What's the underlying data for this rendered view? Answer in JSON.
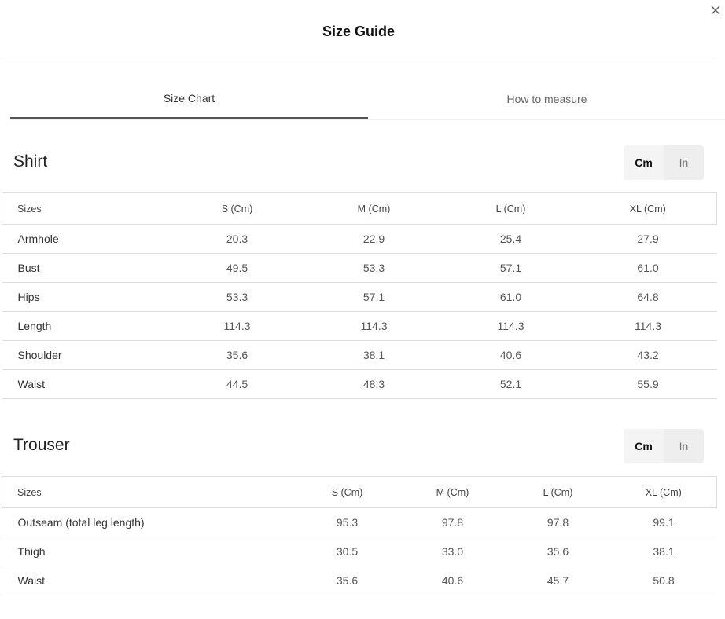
{
  "modal": {
    "title": "Size Guide",
    "close_icon": "close-icon"
  },
  "tabs": [
    {
      "label": "Size Chart",
      "active": true
    },
    {
      "label": "How to measure",
      "active": false
    }
  ],
  "shirt": {
    "title": "Shirt",
    "units": {
      "cm": "Cm",
      "in": "In",
      "selected": "Cm"
    },
    "columns": [
      "Sizes",
      "S (Cm)",
      "M (Cm)",
      "L (Cm)",
      "XL (Cm)"
    ],
    "rows": [
      [
        "Armhole",
        "20.3",
        "22.9",
        "25.4",
        "27.9"
      ],
      [
        "Bust",
        "49.5",
        "53.3",
        "57.1",
        "61.0"
      ],
      [
        "Hips",
        "53.3",
        "57.1",
        "61.0",
        "64.8"
      ],
      [
        "Length",
        "114.3",
        "114.3",
        "114.3",
        "114.3"
      ],
      [
        "Shoulder",
        "35.6",
        "38.1",
        "40.6",
        "43.2"
      ],
      [
        "Waist",
        "44.5",
        "48.3",
        "52.1",
        "55.9"
      ]
    ]
  },
  "trouser": {
    "title": "Trouser",
    "units": {
      "cm": "Cm",
      "in": "In",
      "selected": "Cm"
    },
    "columns": [
      "Sizes",
      "S (Cm)",
      "M (Cm)",
      "L (Cm)",
      "XL (Cm)"
    ],
    "rows": [
      [
        "Outseam (total leg length)",
        "95.3",
        "97.8",
        "97.8",
        "99.1"
      ],
      [
        "Thigh",
        "30.5",
        "33.0",
        "35.6",
        "38.1"
      ],
      [
        "Waist",
        "35.6",
        "40.6",
        "45.7",
        "50.8"
      ]
    ]
  }
}
